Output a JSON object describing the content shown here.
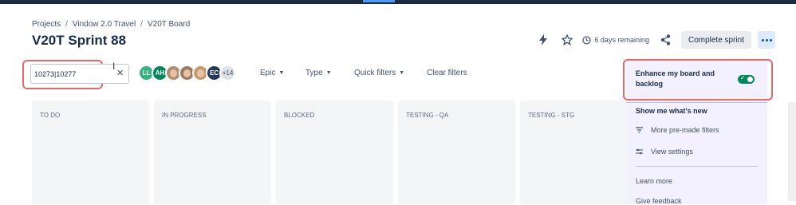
{
  "breadcrumb": {
    "items": [
      "Projects",
      "Vindow 2.0 Travel",
      "V20T Board"
    ],
    "separator": "/"
  },
  "page": {
    "title": "V20T Sprint 88"
  },
  "header": {
    "days_remaining": "6 days remaining",
    "complete_label": "Complete sprint"
  },
  "search": {
    "value": "10273|10277",
    "clear_icon": "close-icon"
  },
  "avatars": {
    "items": [
      {
        "initials": "LL",
        "color": "#36b37e"
      },
      {
        "initials": "AH",
        "color": "#00875a"
      },
      {
        "initials": "",
        "color": "#b08d6e"
      },
      {
        "initials": "",
        "color": "#9c7b62"
      },
      {
        "initials": "",
        "color": "#c49a72"
      },
      {
        "initials": "EC",
        "color": "#253858"
      }
    ],
    "more": "+14"
  },
  "filters": {
    "epic": "Epic",
    "type": "Type",
    "quick": "Quick filters",
    "clear": "Clear filters"
  },
  "columns": [
    "TO DO",
    "IN PROGRESS",
    "BLOCKED",
    "TESTING - QA",
    "TESTING - STG"
  ],
  "panel": {
    "enhance_label": "Enhance my board and backlog",
    "toggle_on": true,
    "show_new": "Show me what's new",
    "more_filters": "More pre-made filters",
    "view_settings": "View settings",
    "learn_more": "Learn more",
    "give_feedback": "Give feedback"
  },
  "colors": {
    "highlight": "#e8696b",
    "panel_bg": "#f3f0ff",
    "toggle_on": "#00875a",
    "title": "#172b4d"
  }
}
